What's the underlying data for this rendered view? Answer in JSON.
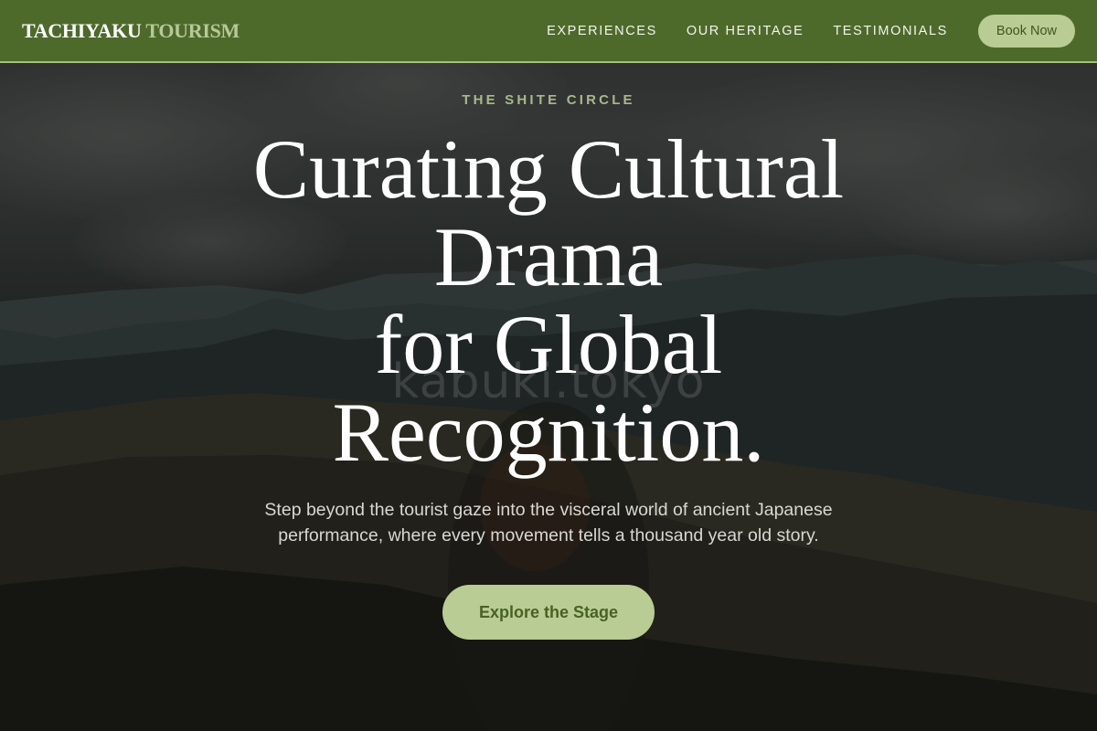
{
  "nav": {
    "brand_primary": "TACHIYAKU",
    "brand_secondary": "TOURISM",
    "links": [
      "EXPERIENCES",
      "OUR HERITAGE",
      "TESTIMONIALS"
    ],
    "cta_label": "Book Now"
  },
  "hero": {
    "eyebrow": "THE SHITE CIRCLE",
    "headline_lines": [
      "Curating Cultural",
      "Drama",
      "for Global",
      "Recognition."
    ],
    "subtext_lines": [
      "Step beyond the tourist gaze into the visceral world of ancient Japanese",
      "performance, where every movement tells a thousand year old story."
    ],
    "cta_label": "Explore the Stage",
    "watermark": "kabuki.tokyo"
  },
  "colors": {
    "nav_bg": "#4e6a2b",
    "accent": "#b9cc93",
    "accent_text": "#4a6125",
    "eyebrow": "#a9b88c"
  }
}
